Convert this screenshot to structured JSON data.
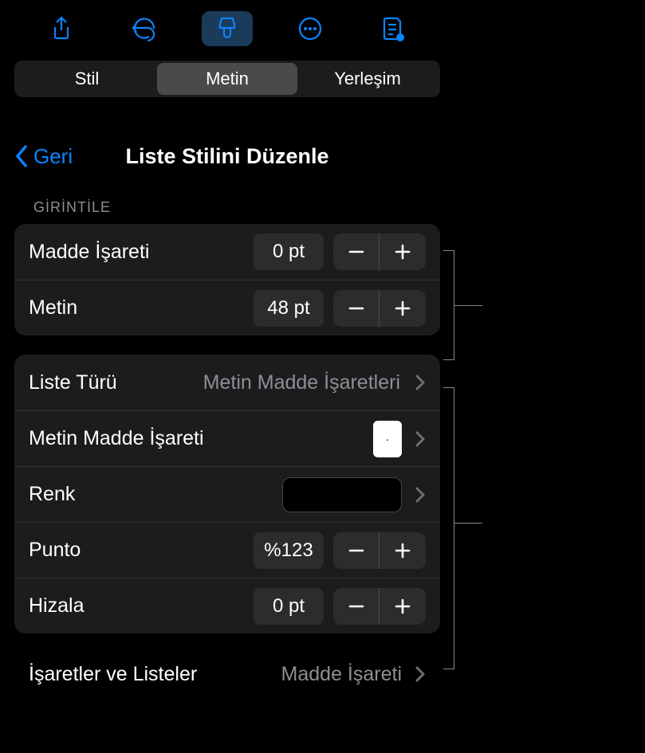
{
  "toolbar": {
    "icons": [
      "share-icon",
      "undo-icon",
      "brush-icon",
      "more-icon",
      "document-icon"
    ]
  },
  "segments": {
    "style": "Stil",
    "text": "Metin",
    "layout": "Yerleşim"
  },
  "nav": {
    "back": "Geri",
    "title": "Liste Stilini Düzenle"
  },
  "indent": {
    "header": "GİRİNTİLE",
    "bullet_label": "Madde İşareti",
    "bullet_value": "0 pt",
    "text_label": "Metin",
    "text_value": "48 pt"
  },
  "list": {
    "type_label": "Liste Türü",
    "type_value": "Metin Madde İşaretleri",
    "bullet_label": "Metin Madde İşareti",
    "bullet_glyph": "·",
    "color_label": "Renk",
    "color_value": "#000000",
    "size_label": "Punto",
    "size_value": "%123",
    "align_label": "Hizala",
    "align_value": "0 pt"
  },
  "crumb": {
    "label": "İşaretler ve Listeler",
    "value": "Madde İşareti"
  }
}
